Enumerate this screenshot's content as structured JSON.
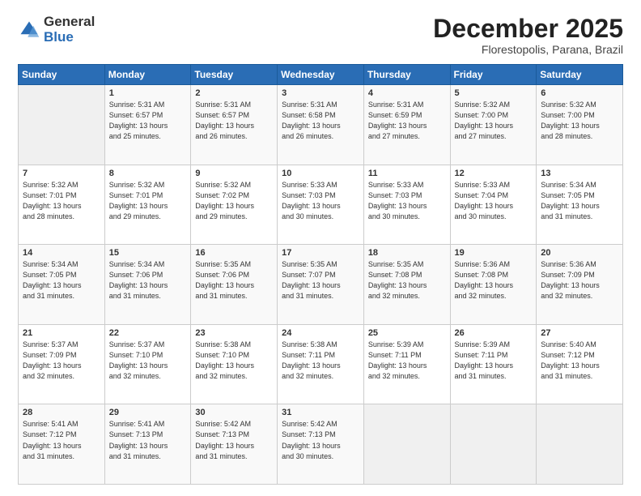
{
  "header": {
    "logo_general": "General",
    "logo_blue": "Blue",
    "month_title": "December 2025",
    "location": "Florestopolis, Parana, Brazil"
  },
  "days_of_week": [
    "Sunday",
    "Monday",
    "Tuesday",
    "Wednesday",
    "Thursday",
    "Friday",
    "Saturday"
  ],
  "weeks": [
    [
      {
        "day": "",
        "info": ""
      },
      {
        "day": "1",
        "info": "Sunrise: 5:31 AM\nSunset: 6:57 PM\nDaylight: 13 hours\nand 25 minutes."
      },
      {
        "day": "2",
        "info": "Sunrise: 5:31 AM\nSunset: 6:57 PM\nDaylight: 13 hours\nand 26 minutes."
      },
      {
        "day": "3",
        "info": "Sunrise: 5:31 AM\nSunset: 6:58 PM\nDaylight: 13 hours\nand 26 minutes."
      },
      {
        "day": "4",
        "info": "Sunrise: 5:31 AM\nSunset: 6:59 PM\nDaylight: 13 hours\nand 27 minutes."
      },
      {
        "day": "5",
        "info": "Sunrise: 5:32 AM\nSunset: 7:00 PM\nDaylight: 13 hours\nand 27 minutes."
      },
      {
        "day": "6",
        "info": "Sunrise: 5:32 AM\nSunset: 7:00 PM\nDaylight: 13 hours\nand 28 minutes."
      }
    ],
    [
      {
        "day": "7",
        "info": "Sunrise: 5:32 AM\nSunset: 7:01 PM\nDaylight: 13 hours\nand 28 minutes."
      },
      {
        "day": "8",
        "info": "Sunrise: 5:32 AM\nSunset: 7:01 PM\nDaylight: 13 hours\nand 29 minutes."
      },
      {
        "day": "9",
        "info": "Sunrise: 5:32 AM\nSunset: 7:02 PM\nDaylight: 13 hours\nand 29 minutes."
      },
      {
        "day": "10",
        "info": "Sunrise: 5:33 AM\nSunset: 7:03 PM\nDaylight: 13 hours\nand 30 minutes."
      },
      {
        "day": "11",
        "info": "Sunrise: 5:33 AM\nSunset: 7:03 PM\nDaylight: 13 hours\nand 30 minutes."
      },
      {
        "day": "12",
        "info": "Sunrise: 5:33 AM\nSunset: 7:04 PM\nDaylight: 13 hours\nand 30 minutes."
      },
      {
        "day": "13",
        "info": "Sunrise: 5:34 AM\nSunset: 7:05 PM\nDaylight: 13 hours\nand 31 minutes."
      }
    ],
    [
      {
        "day": "14",
        "info": "Sunrise: 5:34 AM\nSunset: 7:05 PM\nDaylight: 13 hours\nand 31 minutes."
      },
      {
        "day": "15",
        "info": "Sunrise: 5:34 AM\nSunset: 7:06 PM\nDaylight: 13 hours\nand 31 minutes."
      },
      {
        "day": "16",
        "info": "Sunrise: 5:35 AM\nSunset: 7:06 PM\nDaylight: 13 hours\nand 31 minutes."
      },
      {
        "day": "17",
        "info": "Sunrise: 5:35 AM\nSunset: 7:07 PM\nDaylight: 13 hours\nand 31 minutes."
      },
      {
        "day": "18",
        "info": "Sunrise: 5:35 AM\nSunset: 7:08 PM\nDaylight: 13 hours\nand 32 minutes."
      },
      {
        "day": "19",
        "info": "Sunrise: 5:36 AM\nSunset: 7:08 PM\nDaylight: 13 hours\nand 32 minutes."
      },
      {
        "day": "20",
        "info": "Sunrise: 5:36 AM\nSunset: 7:09 PM\nDaylight: 13 hours\nand 32 minutes."
      }
    ],
    [
      {
        "day": "21",
        "info": "Sunrise: 5:37 AM\nSunset: 7:09 PM\nDaylight: 13 hours\nand 32 minutes."
      },
      {
        "day": "22",
        "info": "Sunrise: 5:37 AM\nSunset: 7:10 PM\nDaylight: 13 hours\nand 32 minutes."
      },
      {
        "day": "23",
        "info": "Sunrise: 5:38 AM\nSunset: 7:10 PM\nDaylight: 13 hours\nand 32 minutes."
      },
      {
        "day": "24",
        "info": "Sunrise: 5:38 AM\nSunset: 7:11 PM\nDaylight: 13 hours\nand 32 minutes."
      },
      {
        "day": "25",
        "info": "Sunrise: 5:39 AM\nSunset: 7:11 PM\nDaylight: 13 hours\nand 32 minutes."
      },
      {
        "day": "26",
        "info": "Sunrise: 5:39 AM\nSunset: 7:11 PM\nDaylight: 13 hours\nand 31 minutes."
      },
      {
        "day": "27",
        "info": "Sunrise: 5:40 AM\nSunset: 7:12 PM\nDaylight: 13 hours\nand 31 minutes."
      }
    ],
    [
      {
        "day": "28",
        "info": "Sunrise: 5:41 AM\nSunset: 7:12 PM\nDaylight: 13 hours\nand 31 minutes."
      },
      {
        "day": "29",
        "info": "Sunrise: 5:41 AM\nSunset: 7:13 PM\nDaylight: 13 hours\nand 31 minutes."
      },
      {
        "day": "30",
        "info": "Sunrise: 5:42 AM\nSunset: 7:13 PM\nDaylight: 13 hours\nand 31 minutes."
      },
      {
        "day": "31",
        "info": "Sunrise: 5:42 AM\nSunset: 7:13 PM\nDaylight: 13 hours\nand 30 minutes."
      },
      {
        "day": "",
        "info": ""
      },
      {
        "day": "",
        "info": ""
      },
      {
        "day": "",
        "info": ""
      }
    ]
  ]
}
